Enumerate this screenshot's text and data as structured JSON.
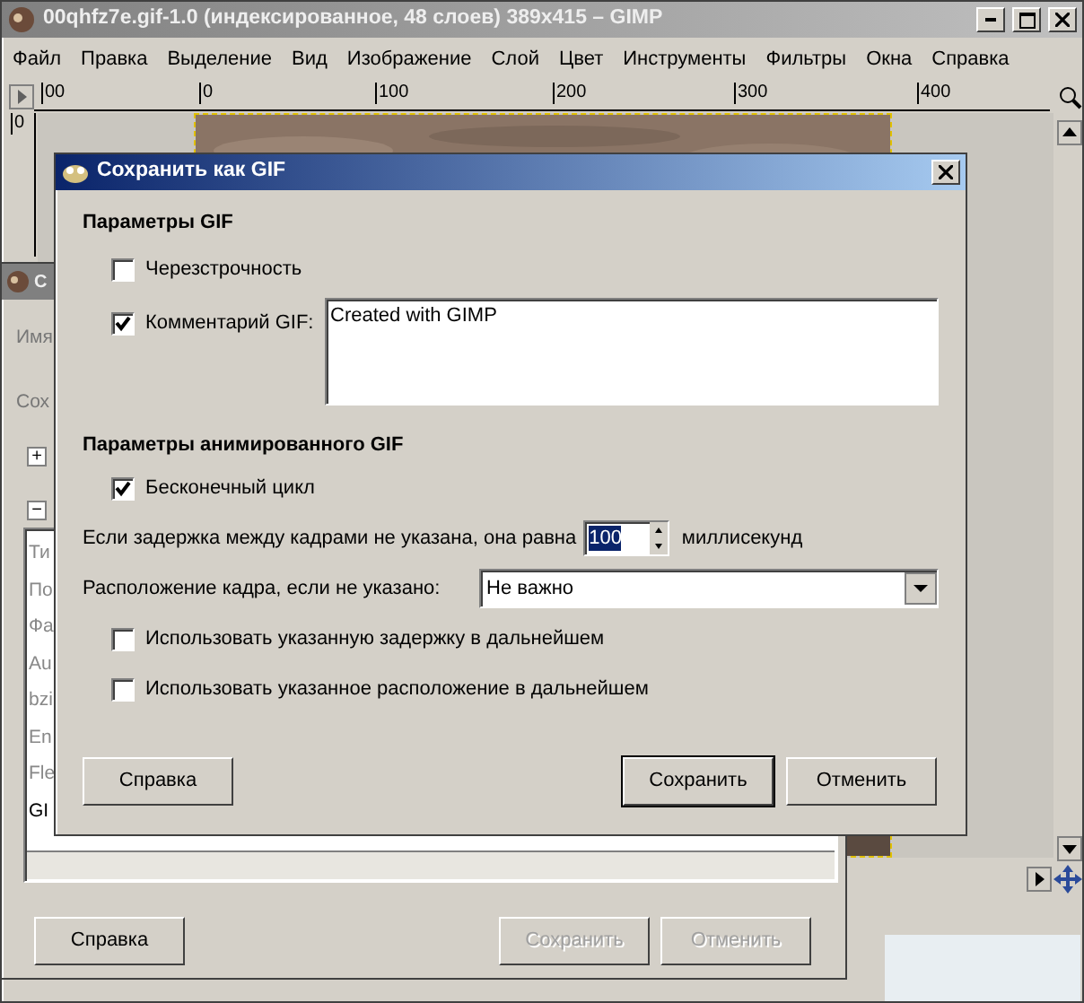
{
  "main_window": {
    "title": "00qhfz7e.gif-1.0 (индексированное, 48 слоев) 389x415 – GIMP",
    "menu": [
      "Файл",
      "Правка",
      "Выделение",
      "Вид",
      "Изображение",
      "Слой",
      "Цвет",
      "Инструменты",
      "Фильтры",
      "Окна",
      "Справка"
    ],
    "ruler_labels": [
      "00",
      "0",
      "100",
      "200",
      "300",
      "400"
    ],
    "vertical_ruler_labels": [
      "0"
    ]
  },
  "back_dialog": {
    "title": "С",
    "labels": [
      "Имя",
      "Сох"
    ],
    "expanders": [
      "+",
      "−"
    ],
    "list_items": [
      "Ти",
      "По",
      "Фа",
      "Au",
      "bzi",
      "En",
      "Fle",
      "GI"
    ],
    "buttons": [
      {
        "label": "Справка",
        "disabled": false
      },
      {
        "label": "Сохранить",
        "disabled": true
      },
      {
        "label": "Отменить",
        "disabled": true
      }
    ]
  },
  "dialog": {
    "title": "Сохранить как GIF",
    "sections": [
      {
        "heading": "Параметры GIF",
        "rows": [
          {
            "kind": "checkbox",
            "label": "Черезстрочность",
            "checked": false
          },
          {
            "kind": "comment",
            "label": "Комментарий GIF:",
            "checked": true,
            "value": "Created with GIMP"
          }
        ]
      },
      {
        "heading": "Параметры анимированного GIF",
        "rows": [
          {
            "kind": "checkbox",
            "label": "Бесконечный цикл",
            "checked": true
          },
          {
            "kind": "spin",
            "label": "Если задержка между кадрами не указана, она равна",
            "value": "100",
            "unit": "миллисекунд"
          },
          {
            "kind": "combo",
            "label": "Расположение кадра, если не указано:",
            "value": "Не важно"
          },
          {
            "kind": "checkbox",
            "label": "Использовать указанную задержку в дальнейшем",
            "checked": false
          },
          {
            "kind": "checkbox",
            "label": "Использовать указанное расположение в дальнейшем",
            "checked": false
          }
        ]
      }
    ],
    "buttons": [
      {
        "label": "Справка",
        "default": false
      },
      {
        "label": "Сохранить",
        "default": true
      },
      {
        "label": "Отменить",
        "default": false
      }
    ]
  }
}
